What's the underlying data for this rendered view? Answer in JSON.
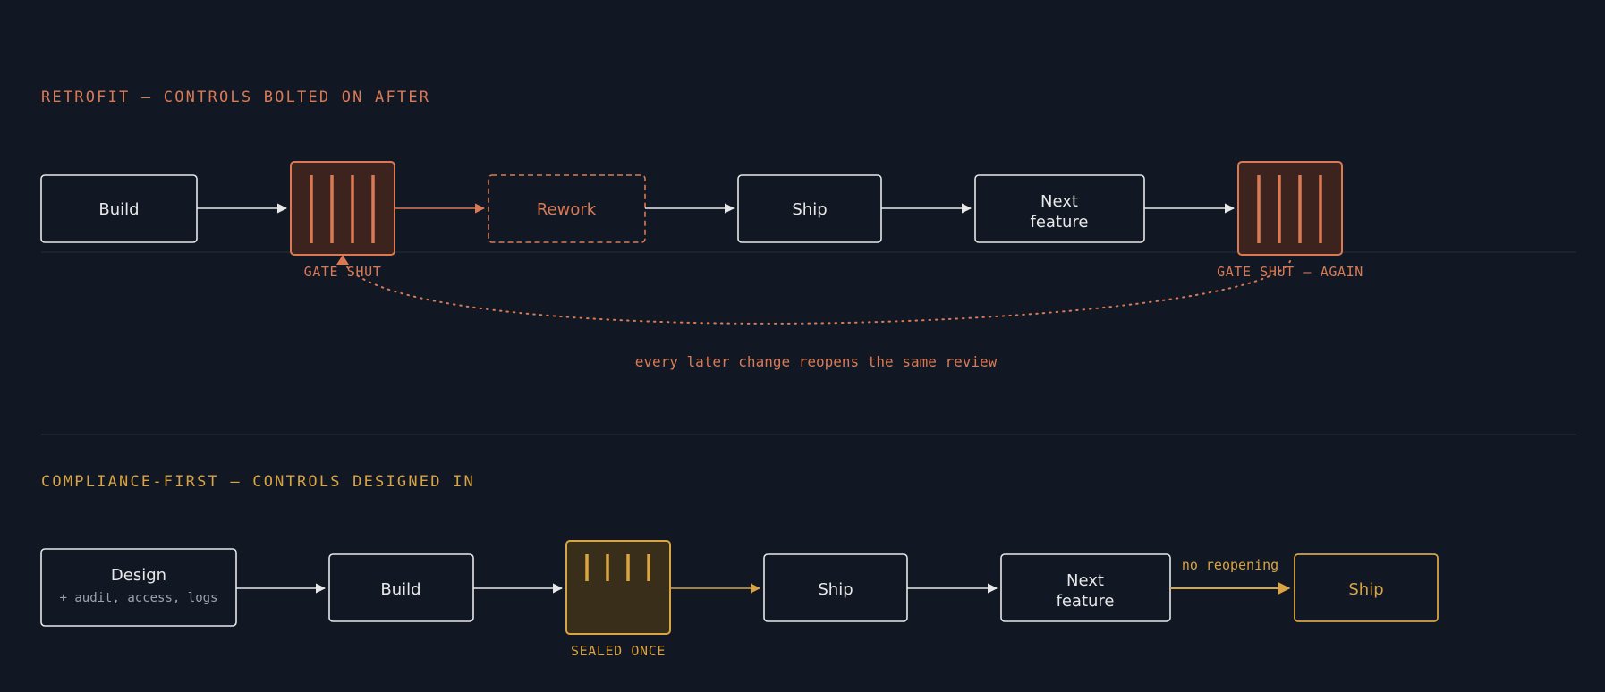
{
  "colors": {
    "background": "#111824",
    "retrofit": "#d97a55",
    "retrofit_fill": "#3c231d",
    "compliance": "#d9a441",
    "compliance_fill": "#382e1a",
    "neutral": "#e8e8e8",
    "muted": "#9aa3ad",
    "rule": "#22333b"
  },
  "retrofit": {
    "heading": "RETROFIT — CONTROLS BOLTED ON AFTER",
    "build": "Build",
    "gate1_label": "GATE SHUT",
    "rework": "Rework",
    "ship": "Ship",
    "next_line1": "Next",
    "next_line2": "feature",
    "gate2_label": "GATE SHUT — AGAIN",
    "loop_note": "every later change reopens the same review"
  },
  "compliance": {
    "heading": "COMPLIANCE-FIRST — CONTROLS DESIGNED IN",
    "design": "Design",
    "design_sub": "+ audit, access, logs",
    "build": "Build",
    "sealed_label": "SEALED ONCE",
    "ship": "Ship",
    "next_line1": "Next",
    "next_line2": "feature",
    "no_reopen": "no reopening",
    "ship_final": "Ship"
  }
}
